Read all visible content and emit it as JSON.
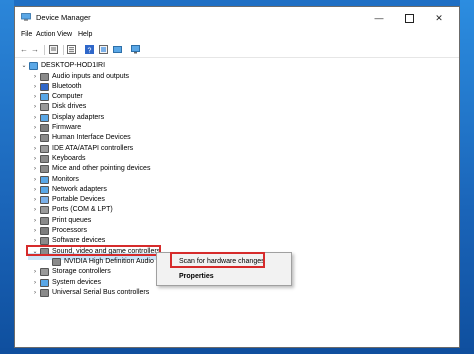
{
  "window": {
    "title": "Device Manager",
    "controls": {
      "minimize": "—",
      "maximize": "",
      "close": "✕"
    }
  },
  "menu": [
    "File",
    "Action",
    "View",
    "Help"
  ],
  "toolbar": {
    "back": "←",
    "forward": "→",
    "help": "?"
  },
  "tree": {
    "root": "DESKTOP-HOD1IRI",
    "items": [
      {
        "label": "Audio inputs and outputs",
        "icon": "speaker-icon"
      },
      {
        "label": "Bluetooth",
        "icon": "bluetooth-icon"
      },
      {
        "label": "Computer",
        "icon": "computer-icon"
      },
      {
        "label": "Disk drives",
        "icon": "disk-icon"
      },
      {
        "label": "Display adapters",
        "icon": "display-icon"
      },
      {
        "label": "Firmware",
        "icon": "firmware-icon"
      },
      {
        "label": "Human Interface Devices",
        "icon": "hid-icon"
      },
      {
        "label": "IDE ATA/ATAPI controllers",
        "icon": "ide-icon"
      },
      {
        "label": "Keyboards",
        "icon": "keyboard-icon"
      },
      {
        "label": "Mice and other pointing devices",
        "icon": "mouse-icon"
      },
      {
        "label": "Monitors",
        "icon": "monitor-icon"
      },
      {
        "label": "Network adapters",
        "icon": "network-icon"
      },
      {
        "label": "Portable Devices",
        "icon": "portable-icon"
      },
      {
        "label": "Ports (COM & LPT)",
        "icon": "port-icon"
      },
      {
        "label": "Print queues",
        "icon": "printer-icon"
      },
      {
        "label": "Processors",
        "icon": "processor-icon"
      },
      {
        "label": "Software devices",
        "icon": "software-icon"
      },
      {
        "label": "Sound, video and game controllers",
        "icon": "sound-icon",
        "expanded": true,
        "selected": true
      },
      {
        "label": "NVIDIA High Definition Audio",
        "icon": "speaker-icon",
        "child": true
      },
      {
        "label": "Storage controllers",
        "icon": "storage-icon"
      },
      {
        "label": "System devices",
        "icon": "system-icon"
      },
      {
        "label": "Universal Serial Bus controllers",
        "icon": "usb-icon"
      }
    ]
  },
  "context_menu": {
    "scan": "Scan for hardware changes",
    "properties": "Properties"
  },
  "colors": {
    "highlight_border": "#d62b2b",
    "selection": "#cce4f7",
    "desktop": "#1f6fc4"
  }
}
